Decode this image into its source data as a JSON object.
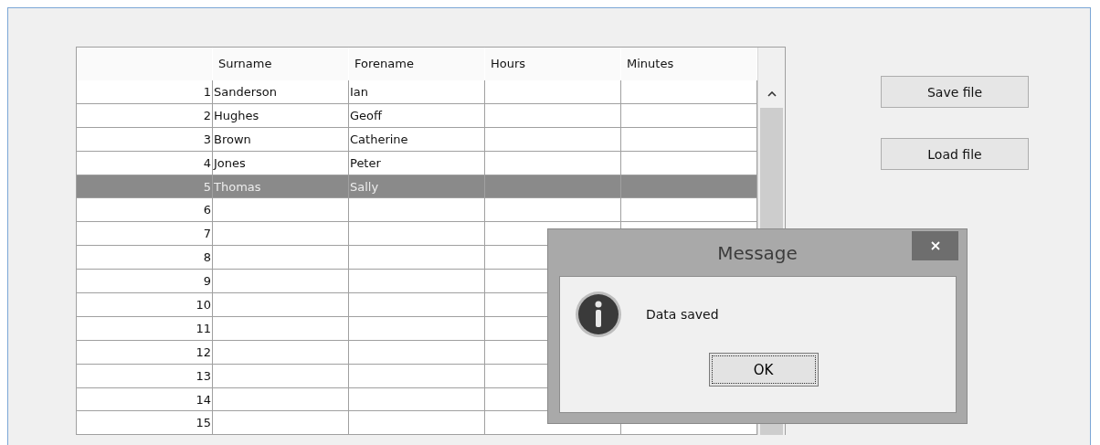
{
  "table": {
    "columns": [
      "Surname",
      "Forename",
      "Hours",
      "Minutes"
    ],
    "rows": [
      {
        "number": "1",
        "cells": [
          "Sanderson",
          "Ian"
        ],
        "selected": false
      },
      {
        "number": "2",
        "cells": [
          "Hughes",
          "Geoff"
        ],
        "selected": false
      },
      {
        "number": "3",
        "cells": [
          "Brown",
          "Catherine"
        ],
        "selected": false
      },
      {
        "number": "4",
        "cells": [
          "Jones",
          "Peter"
        ],
        "selected": false
      },
      {
        "number": "5",
        "cells": [
          "Thomas",
          "Sally"
        ],
        "selected": true
      },
      {
        "number": "6",
        "cells": [],
        "selected": false
      },
      {
        "number": "7",
        "cells": [],
        "selected": false
      },
      {
        "number": "8",
        "cells": [],
        "selected": false
      },
      {
        "number": "9",
        "cells": [],
        "selected": false
      },
      {
        "number": "10",
        "cells": [],
        "selected": false
      },
      {
        "number": "11",
        "cells": [],
        "selected": false
      },
      {
        "number": "12",
        "cells": [],
        "selected": false
      },
      {
        "number": "13",
        "cells": [],
        "selected": false
      },
      {
        "number": "14",
        "cells": [],
        "selected": false
      },
      {
        "number": "15",
        "cells": [],
        "selected": false
      }
    ]
  },
  "buttons": [
    "Save file",
    "Load file"
  ],
  "dialog": {
    "title": "Message",
    "message": "Data saved",
    "button": "OK"
  }
}
